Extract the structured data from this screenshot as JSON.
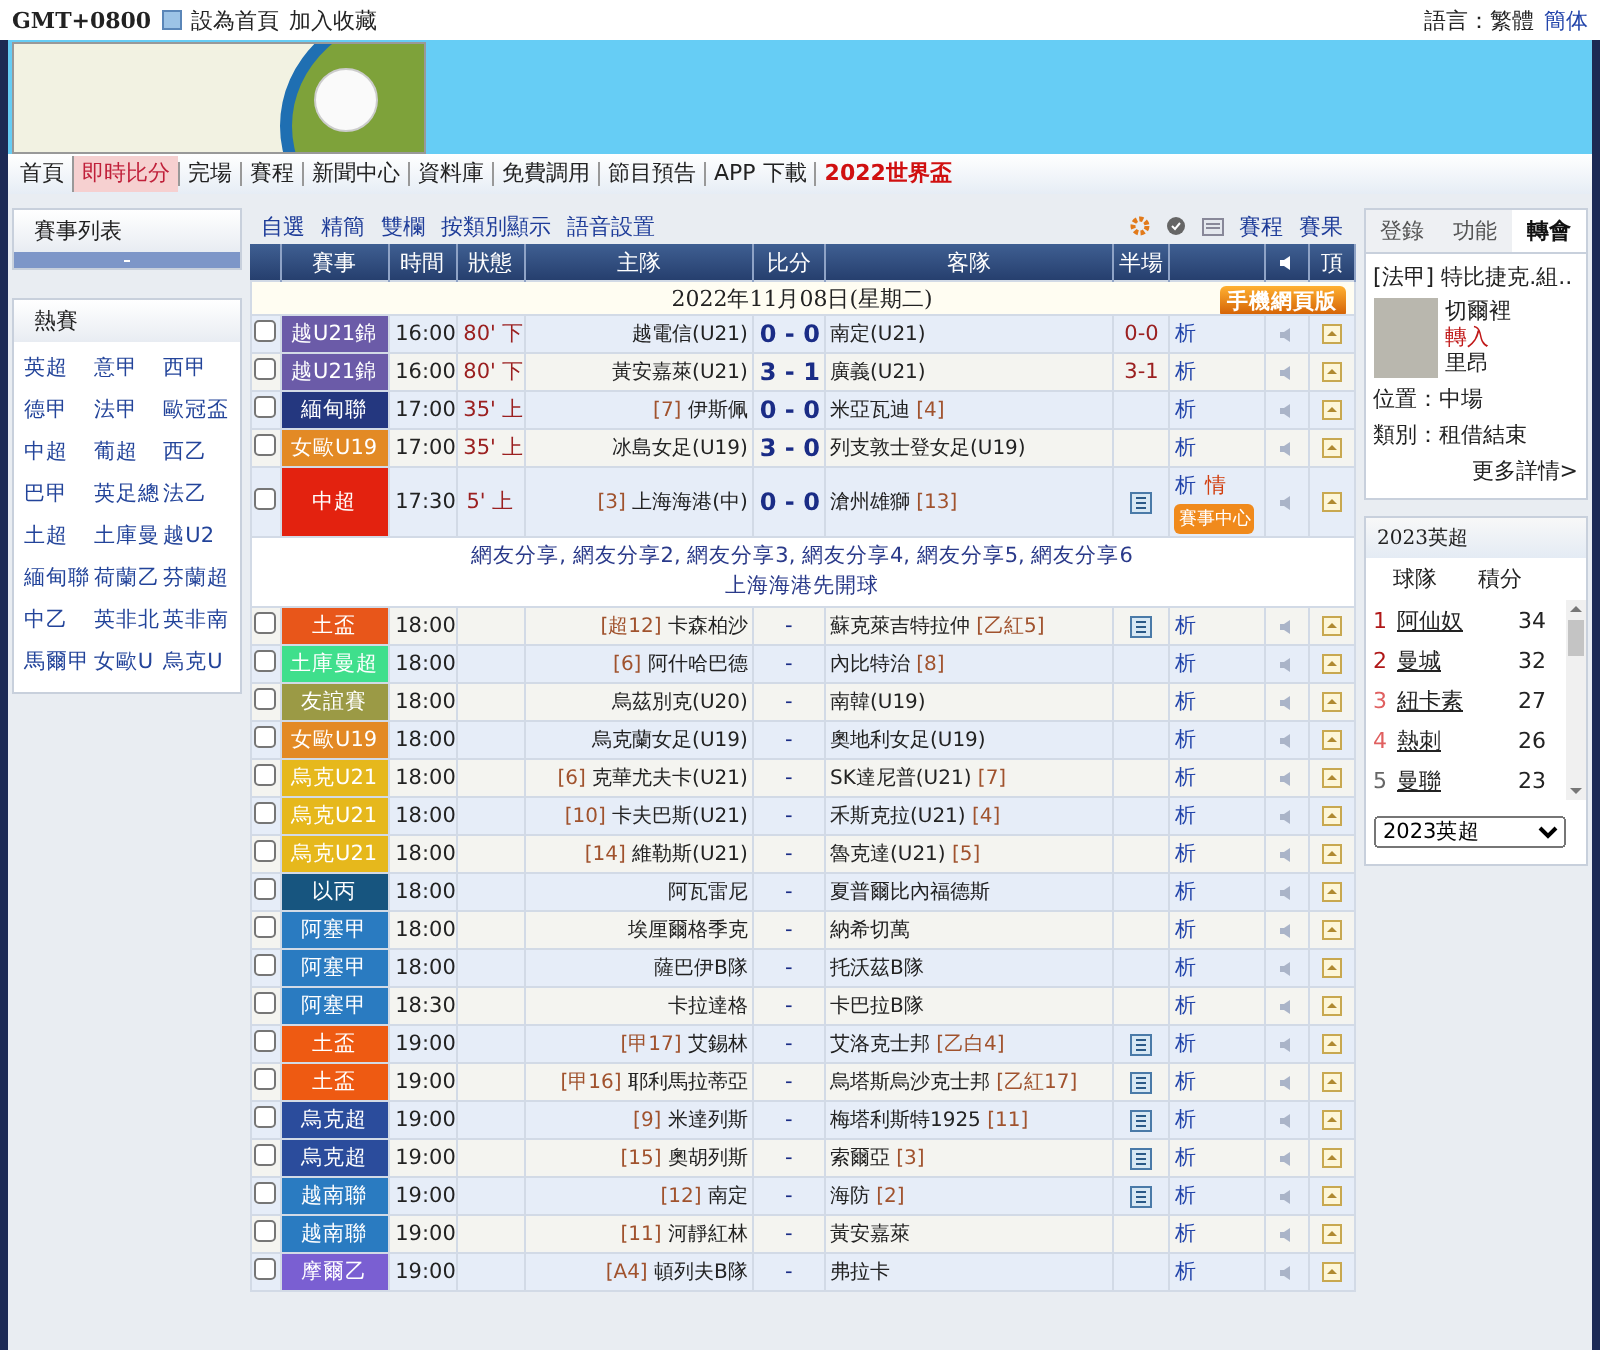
{
  "top_bar": {
    "timezone": "GMT+0800",
    "links": [
      "設為首頁",
      "加入收藏"
    ],
    "language_label": "語言：繁體",
    "language_alt": "簡体"
  },
  "nav": [
    {
      "label": "首頁",
      "selected": false,
      "kind": "link"
    },
    {
      "label": "即時比分",
      "selected": true,
      "kind": "link"
    },
    {
      "label": "完場",
      "selected": false,
      "kind": "link"
    },
    {
      "label": "賽程",
      "selected": false,
      "kind": "link"
    },
    {
      "label": "新聞中心",
      "selected": false,
      "kind": "link"
    },
    {
      "label": "資料庫",
      "selected": false,
      "kind": "link"
    },
    {
      "label": "免費調用",
      "selected": false,
      "kind": "link"
    },
    {
      "label": "節目預告",
      "selected": false,
      "kind": "link"
    },
    {
      "label": "APP 下載",
      "selected": false,
      "kind": "link"
    },
    {
      "label": "2022世界盃",
      "selected": false,
      "kind": "highlight"
    }
  ],
  "sidebar": {
    "list_title": "賽事列表",
    "hot_title": "熱賽",
    "leagues": [
      "英超",
      "意甲",
      "西甲",
      "德甲",
      "法甲",
      "歐冠盃",
      "中超",
      "葡超",
      "西乙",
      "巴甲",
      "英足總",
      "法乙",
      "土超",
      "土庫曼",
      "越U2",
      "緬甸聯",
      "荷蘭乙",
      "芬蘭超",
      "中乙",
      "英非北",
      "英非南",
      "馬爾甲",
      "女歐U",
      "烏克U"
    ]
  },
  "toolbar": {
    "left": [
      "自選",
      "精簡",
      "雙欄",
      "按類別顯示",
      "語音設置"
    ],
    "right": [
      "賽程",
      "賽果"
    ]
  },
  "table": {
    "columns": [
      "賽事",
      "時間",
      "狀態",
      "主隊",
      "比分",
      "客隊",
      "半場"
    ],
    "top_column": "頂",
    "date": "2022年11月08日(星期二)",
    "mobile_badge": "手機網頁版",
    "rows": [
      {
        "kind": "match",
        "checked": false,
        "league": "越U21錦",
        "color": "#6b5ba8",
        "time": "16:00",
        "status": "80' 下",
        "home": "越電信(U21)",
        "score": "0 - 0",
        "away": "南定(U21)",
        "half": "0-0",
        "icon": false,
        "analysis": "析"
      },
      {
        "kind": "match",
        "checked": false,
        "league": "越U21錦",
        "color": "#6b5ba8",
        "time": "16:00",
        "status": "80' 下",
        "home": "黃安嘉萊(U21)",
        "score": "3 - 1",
        "away": "廣義(U21)",
        "half": "3-1",
        "icon": false,
        "analysis": "析"
      },
      {
        "kind": "match",
        "checked": false,
        "league": "緬甸聯",
        "color": "#24377f",
        "time": "17:00",
        "status": "35' 上",
        "home_rank": "[7]",
        "home": "伊斯佩",
        "score": "0 - 0",
        "away": "米亞瓦迪",
        "away_rank": "[4]",
        "icon": false,
        "analysis": "析"
      },
      {
        "kind": "match",
        "checked": false,
        "league": "女歐U19",
        "color": "#e38a25",
        "time": "17:00",
        "status": "35' 上",
        "home": "冰島女足(U19)",
        "score": "3 - 0",
        "away": "列支敦士登女足(U19)",
        "icon": false,
        "analysis": "析"
      },
      {
        "kind": "match",
        "checked": false,
        "league": "中超",
        "color": "#e3220f",
        "time": "17:30",
        "status": "5' 上",
        "home_rank": "[3]",
        "home": "上海海港(中)",
        "score": "0 - 0",
        "away": "滄州雄獅",
        "away_rank": "[13]",
        "icon": true,
        "analysis": "析",
        "info": "情",
        "center_button": "賽事中心"
      },
      {
        "kind": "note",
        "shares": "網友分享, 網友分享2, 網友分享3, 網友分享4, 網友分享5, 網友分享6",
        "text": "上海海港先開球"
      },
      {
        "kind": "match",
        "checked": false,
        "league": "土盃",
        "color": "#e8561a",
        "time": "18:00",
        "home_rank": "[超12]",
        "home": "卡森柏沙",
        "score": "-",
        "away": "蘇克萊吉特拉仲",
        "away_rank": "[乙紅5]",
        "icon": true,
        "analysis": "析"
      },
      {
        "kind": "match",
        "checked": false,
        "league": "土庫曼超",
        "color": "#3fdf8c",
        "time": "18:00",
        "home_rank": "[6]",
        "home": "阿什哈巴德",
        "score": "-",
        "away": "內比特治",
        "away_rank": "[8]",
        "icon": false,
        "analysis": "析"
      },
      {
        "kind": "match",
        "checked": false,
        "league": "友誼賽",
        "color": "#9b9a45",
        "time": "18:00",
        "home": "烏茲別克(U20)",
        "score": "-",
        "away": "南韓(U19)",
        "icon": false,
        "analysis": "析"
      },
      {
        "kind": "match",
        "checked": false,
        "league": "女歐U19",
        "color": "#e38a25",
        "time": "18:00",
        "home": "烏克蘭女足(U19)",
        "score": "-",
        "away": "奧地利女足(U19)",
        "icon": false,
        "analysis": "析"
      },
      {
        "kind": "match",
        "checked": false,
        "league": "烏克U21",
        "color": "#e6b81c",
        "time": "18:00",
        "home_rank": "[6]",
        "home": "克華尤夫卡(U21)",
        "score": "-",
        "away": "SK達尼普(U21)",
        "away_rank": "[7]",
        "icon": false,
        "analysis": "析"
      },
      {
        "kind": "match",
        "checked": false,
        "league": "烏克U21",
        "color": "#e6b81c",
        "time": "18:00",
        "home_rank": "[10]",
        "home": "卡夫巴斯(U21)",
        "score": "-",
        "away": "禾斯克拉(U21)",
        "away_rank": "[4]",
        "icon": false,
        "analysis": "析"
      },
      {
        "kind": "match",
        "checked": false,
        "league": "烏克U21",
        "color": "#e6b81c",
        "time": "18:00",
        "home_rank": "[14]",
        "home": "維勒斯(U21)",
        "score": "-",
        "away": "魯克達(U21)",
        "away_rank": "[5]",
        "icon": false,
        "analysis": "析"
      },
      {
        "kind": "match",
        "checked": false,
        "league": "以丙",
        "color": "#17557f",
        "time": "18:00",
        "home": "阿瓦雷尼",
        "score": "-",
        "away": "夏普爾比內福德斯",
        "icon": false,
        "analysis": "析"
      },
      {
        "kind": "match",
        "checked": false,
        "league": "阿塞甲",
        "color": "#2a7bc1",
        "time": "18:00",
        "home": "埃厘爾格季克",
        "score": "-",
        "away": "納希切萬",
        "icon": false,
        "analysis": "析"
      },
      {
        "kind": "match",
        "checked": false,
        "league": "阿塞甲",
        "color": "#2a7bc1",
        "time": "18:00",
        "home": "薩巴伊B隊",
        "score": "-",
        "away": "托沃茲B隊",
        "icon": false,
        "analysis": "析"
      },
      {
        "kind": "match",
        "checked": false,
        "league": "阿塞甲",
        "color": "#2a7bc1",
        "time": "18:30",
        "home": "卡拉達格",
        "score": "-",
        "away": "卡巴拉B隊",
        "icon": false,
        "analysis": "析"
      },
      {
        "kind": "match",
        "checked": false,
        "league": "土盃",
        "color": "#ee5a12",
        "time": "19:00",
        "home_rank": "[甲17]",
        "home": "艾錫林",
        "score": "-",
        "away": "艾洛克士邦",
        "away_rank": "[乙白4]",
        "icon": true,
        "analysis": "析"
      },
      {
        "kind": "match",
        "checked": false,
        "league": "土盃",
        "color": "#ee5a12",
        "time": "19:00",
        "home_rank": "[甲16]",
        "home": "耶利馬拉蒂亞",
        "score": "-",
        "away": "烏塔斯烏沙克士邦",
        "away_rank": "[乙紅17]",
        "icon": true,
        "analysis": "析"
      },
      {
        "kind": "match",
        "checked": false,
        "league": "烏克超",
        "color": "#2b4c9c",
        "time": "19:00",
        "home_rank": "[9]",
        "home": "米達列斯",
        "score": "-",
        "away": "梅塔利斯特1925",
        "away_rank": "[11]",
        "icon": true,
        "analysis": "析"
      },
      {
        "kind": "match",
        "checked": false,
        "league": "烏克超",
        "color": "#2b4c9c",
        "time": "19:00",
        "home_rank": "[15]",
        "home": "奧胡列斯",
        "score": "-",
        "away": "索爾亞",
        "away_rank": "[3]",
        "icon": true,
        "analysis": "析"
      },
      {
        "kind": "match",
        "checked": false,
        "league": "越南聯",
        "color": "#2a7bc1",
        "time": "19:00",
        "home_rank": "[12]",
        "home": "南定",
        "score": "-",
        "away": "海防",
        "away_rank": "[2]",
        "icon": true,
        "analysis": "析"
      },
      {
        "kind": "match",
        "checked": false,
        "league": "越南聯",
        "color": "#2a7bc1",
        "time": "19:00",
        "home_rank": "[11]",
        "home": "河靜紅林",
        "score": "-",
        "away": "黃安嘉萊",
        "icon": false,
        "analysis": "析"
      },
      {
        "kind": "match",
        "checked": false,
        "league": "摩爾乙",
        "color": "#7a5fd2",
        "time": "19:00",
        "home_rank": "[A4]",
        "home": "頓列夫B隊",
        "score": "-",
        "away": "弗拉卡",
        "icon": false,
        "analysis": "析"
      }
    ]
  },
  "right_panel": {
    "tabs": [
      {
        "label": "登錄",
        "selected": false
      },
      {
        "label": "功能",
        "selected": false
      },
      {
        "label": "轉會",
        "selected": true
      }
    ],
    "transfer": {
      "headline": "[法甲] 特比捷克.組..",
      "player": "切爾裡",
      "direction": "轉入",
      "club": "里昂",
      "position": "位置：中場",
      "type": "類別：租借結束",
      "more": "更多詳情>"
    },
    "standings": {
      "title": "2023英超",
      "columns": [
        "球隊",
        "積分"
      ],
      "rows": [
        {
          "rank": "1",
          "color": "#b01818",
          "team": "阿仙奴",
          "points": "34"
        },
        {
          "rank": "2",
          "color": "#b01818",
          "team": "曼城",
          "points": "32"
        },
        {
          "rank": "3",
          "color": "#e06060",
          "team": "紐卡素",
          "points": "27"
        },
        {
          "rank": "4",
          "color": "#e06060",
          "team": "熱刺",
          "points": "26"
        },
        {
          "rank": "5",
          "color": "#666666",
          "team": "曼聯",
          "points": "23"
        }
      ],
      "select": "2023英超"
    }
  }
}
